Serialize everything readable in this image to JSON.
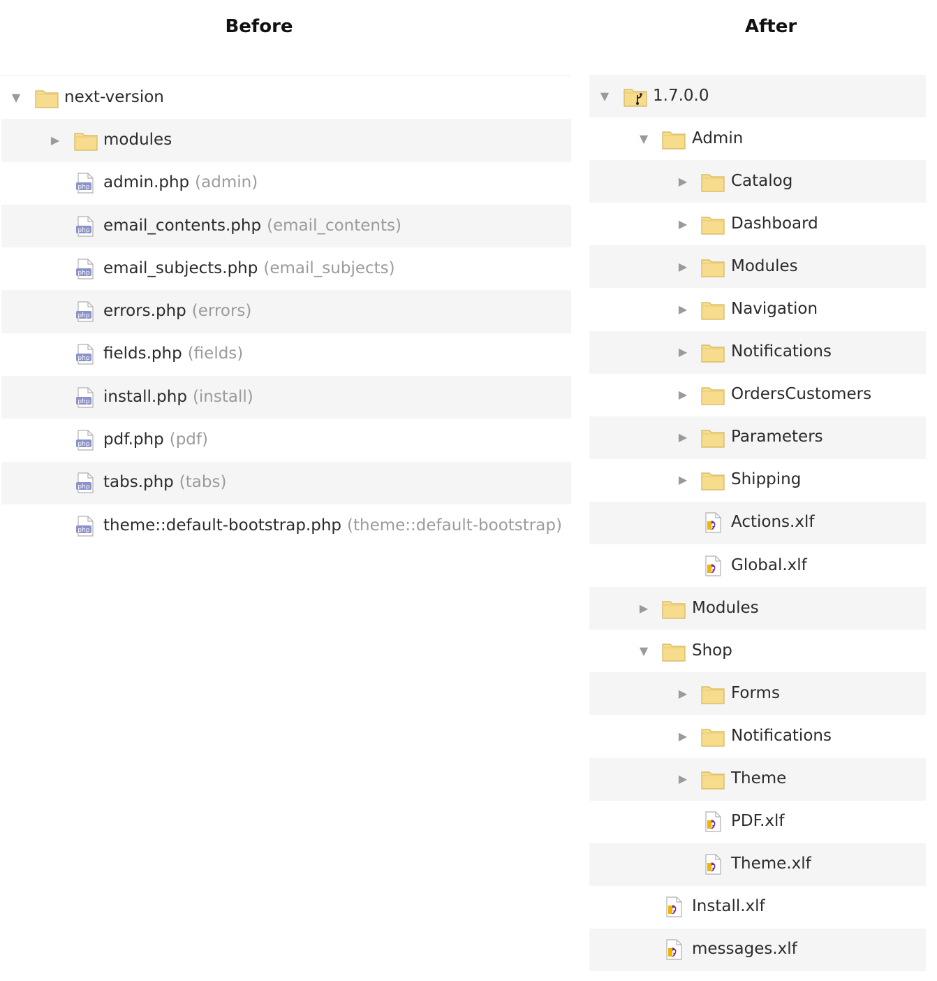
{
  "columns": {
    "before_title": "Before",
    "after_title": "After"
  },
  "before": {
    "rows": [
      {
        "name": "next-version",
        "type": "folder",
        "expanded": true,
        "arrow": "▼"
      },
      {
        "name": "modules",
        "type": "folder",
        "expanded": false,
        "arrow": "▶"
      },
      {
        "name": "admin.php",
        "sub": "(admin)",
        "type": "php"
      },
      {
        "name": "email_contents.php",
        "sub": "(email_contents)",
        "type": "php"
      },
      {
        "name": "email_subjects.php",
        "sub": "(email_subjects)",
        "type": "php"
      },
      {
        "name": "errors.php",
        "sub": "(errors)",
        "type": "php"
      },
      {
        "name": "fields.php",
        "sub": "(fields)",
        "type": "php"
      },
      {
        "name": "install.php",
        "sub": "(install)",
        "type": "php"
      },
      {
        "name": "pdf.php",
        "sub": "(pdf)",
        "type": "php"
      },
      {
        "name": "tabs.php",
        "sub": "(tabs)",
        "type": "php"
      },
      {
        "name": "theme::default-bootstrap.php",
        "sub": "(theme::default-bootstrap)",
        "type": "php"
      }
    ]
  },
  "after": {
    "rows": [
      {
        "name": "1.7.0.0",
        "type": "repo-folder",
        "expanded": true,
        "arrow": "▼"
      },
      {
        "name": "Admin",
        "type": "folder",
        "expanded": true,
        "arrow": "▼"
      },
      {
        "name": "Catalog",
        "type": "folder",
        "expanded": false,
        "arrow": "▶"
      },
      {
        "name": "Dashboard",
        "type": "folder",
        "expanded": false,
        "arrow": "▶"
      },
      {
        "name": "Modules",
        "type": "folder",
        "expanded": false,
        "arrow": "▶"
      },
      {
        "name": "Navigation",
        "type": "folder",
        "expanded": false,
        "arrow": "▶"
      },
      {
        "name": "Notifications",
        "type": "folder",
        "expanded": false,
        "arrow": "▶"
      },
      {
        "name": "OrdersCustomers",
        "type": "folder",
        "expanded": false,
        "arrow": "▶"
      },
      {
        "name": "Parameters",
        "type": "folder",
        "expanded": false,
        "arrow": "▶"
      },
      {
        "name": "Shipping",
        "type": "folder",
        "expanded": false,
        "arrow": "▶"
      },
      {
        "name": "Actions.xlf",
        "type": "xlf"
      },
      {
        "name": "Global.xlf",
        "type": "xlf"
      },
      {
        "name": "Modules",
        "type": "folder",
        "expanded": false,
        "arrow": "▶"
      },
      {
        "name": "Shop",
        "type": "folder",
        "expanded": true,
        "arrow": "▼"
      },
      {
        "name": "Forms",
        "type": "folder",
        "expanded": false,
        "arrow": "▶"
      },
      {
        "name": "Notifications",
        "type": "folder",
        "expanded": false,
        "arrow": "▶"
      },
      {
        "name": "Theme",
        "type": "folder",
        "expanded": false,
        "arrow": "▶"
      },
      {
        "name": "PDF.xlf",
        "type": "xlf"
      },
      {
        "name": "Theme.xlf",
        "type": "xlf"
      },
      {
        "name": "Install.xlf",
        "type": "xlf"
      },
      {
        "name": "messages.xlf",
        "type": "xlf"
      }
    ]
  },
  "icons": {
    "folder": "folder-icon",
    "repo_folder": "git-folder-icon",
    "php": "php-file-icon",
    "xlf": "xlf-file-icon",
    "expanded": "triangle-down-icon",
    "collapsed": "triangle-right-icon"
  },
  "colors": {
    "folder_fill": "#f6dc8c",
    "folder_stroke": "#d4b65a",
    "php_badge": "#8a93c9",
    "row_shade": "#f5f5f5",
    "secondary_text": "#9b9b9b"
  }
}
